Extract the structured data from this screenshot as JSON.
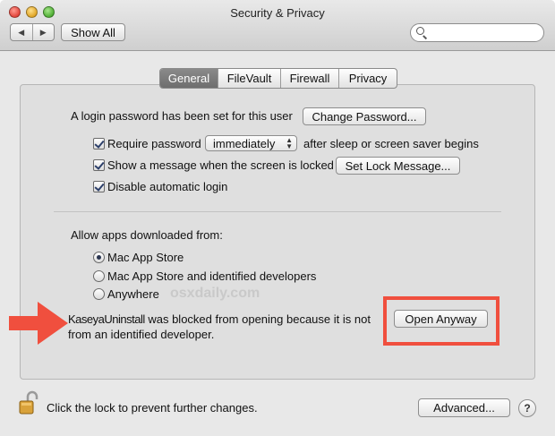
{
  "window": {
    "title": "Security & Privacy"
  },
  "toolbar": {
    "back_glyph": "◀",
    "forward_glyph": "▶",
    "show_all_label": "Show All",
    "search_placeholder": ""
  },
  "tabs": [
    {
      "label": "General",
      "active": true
    },
    {
      "label": "FileVault",
      "active": false
    },
    {
      "label": "Firewall",
      "active": false
    },
    {
      "label": "Privacy",
      "active": false
    }
  ],
  "general": {
    "login_password_text": "A login password has been set for this user",
    "change_password_label": "Change Password...",
    "require_password_label": "Require password",
    "require_password_checked": true,
    "require_password_select": "immediately",
    "after_sleep_text": "after sleep or screen saver begins",
    "show_message_label": "Show a message when the screen is locked",
    "show_message_checked": true,
    "set_lock_message_label": "Set Lock Message...",
    "disable_auto_login_label": "Disable automatic login",
    "disable_auto_login_checked": true
  },
  "gatekeeper": {
    "heading": "Allow apps downloaded from:",
    "options": [
      {
        "label": "Mac App Store",
        "selected": true
      },
      {
        "label": "Mac App Store and identified developers",
        "selected": false
      },
      {
        "label": "Anywhere",
        "selected": false
      }
    ],
    "blocked_app": "KaseyaUninstall",
    "blocked_line1": "was blocked from opening because it is not",
    "blocked_line2": "from an identified developer.",
    "open_anyway_label": "Open Anyway"
  },
  "watermark": "osxdaily.com",
  "footer": {
    "lock_text": "Click the lock to prevent further changes.",
    "advanced_label": "Advanced...",
    "help_label": "?"
  },
  "colors": {
    "highlight_red": "#f04f3e",
    "tab_active": "#7a7a7a",
    "window_bg": "#e8e8e8"
  },
  "icons": {
    "lock": "unlocked-padlock-icon",
    "search": "magnifier-icon",
    "arrow": "red-arrow-icon"
  }
}
